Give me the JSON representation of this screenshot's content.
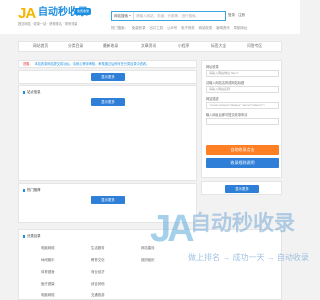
{
  "header": {
    "logo_mark": "JA",
    "logo_text": "自动秒收录",
    "logo_badge": "免费收录",
    "slogan": "提交网站 · 收录一站 · 获得排名 · 带来流量",
    "search": {
      "select_value": "网站搜索",
      "placeholder": "请输入网站、关键、分类等、进行搜索。"
    },
    "links": [
      "登录",
      "注册"
    ],
    "hot_label": "热门搜索：",
    "hot_words": [
      "免费收录",
      "出口工具",
      "公众号",
      "电子商务",
      "网站收录",
      "新闻资讯",
      "导航网址"
    ]
  },
  "nav": [
    "网站首页",
    "分类目录",
    "最新收录",
    "文章资讯",
    "小程序",
    "标签大全",
    "问答专区"
  ],
  "notice": {
    "tag": "提醒：",
    "text": "本站收录网站提交成功后，请耐心等待审核，审核通过后即可在分类目录中查看。"
  },
  "main_panel": {
    "title": "提交收录",
    "button": "显示更多"
  },
  "mid_panel": {
    "title": "站点信息",
    "button": "显示更多"
  },
  "side": {
    "label_1": "网址收录",
    "field_1": "请输入网站地址 http://",
    "label_2": "请输入网站名称或网站标题",
    "field_2": "请输入网站名称",
    "label_3": "网站描述",
    "field_3": "<meta content=\"always\" name=\"referrer\">",
    "label_4": "输入网址后即可提交收录申请",
    "btn_primary": "自助收录点击",
    "btn_secondary": "收录规则说明",
    "btn_more": "显示更多"
  },
  "low_panel": {
    "title": "热门推荐",
    "button": "显示更多"
  },
  "categories": {
    "title": "分类目录",
    "items": [
      "电脑网络",
      "生活服务",
      "休闲娱乐",
      "教育文化",
      "体育健身",
      "商业经济",
      "医疗健康",
      "综合其他",
      "电脑网络",
      "交通旅游",
      "网站建设",
      "政府组织"
    ]
  },
  "watermark": {
    "mark": "JA",
    "text": "自动秒收录",
    "slogan": "做上排名 → 成功一天 → 自动收录"
  }
}
